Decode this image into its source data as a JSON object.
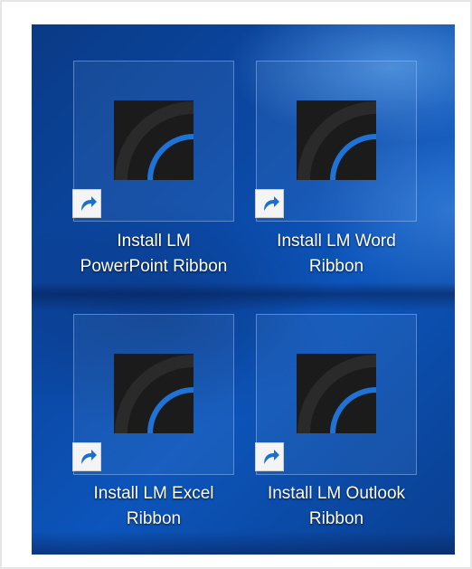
{
  "desktop": {
    "shortcuts": [
      {
        "label_line1": "Install LM",
        "label_line2": "PowerPoint Ribbon",
        "icon": "lm-app-icon"
      },
      {
        "label_line1": "Install LM Word",
        "label_line2": "Ribbon",
        "icon": "lm-app-icon"
      },
      {
        "label_line1": "Install LM Excel",
        "label_line2": "Ribbon",
        "icon": "lm-app-icon"
      },
      {
        "label_line1": "Install LM Outlook",
        "label_line2": "Ribbon",
        "icon": "lm-app-icon"
      }
    ],
    "overlay_icon": "shortcut-arrow-icon",
    "colors": {
      "icon_bg": "#1b1b1b",
      "icon_arc": "#1f73d6",
      "desktop_blue": "#0b4aa8"
    }
  }
}
